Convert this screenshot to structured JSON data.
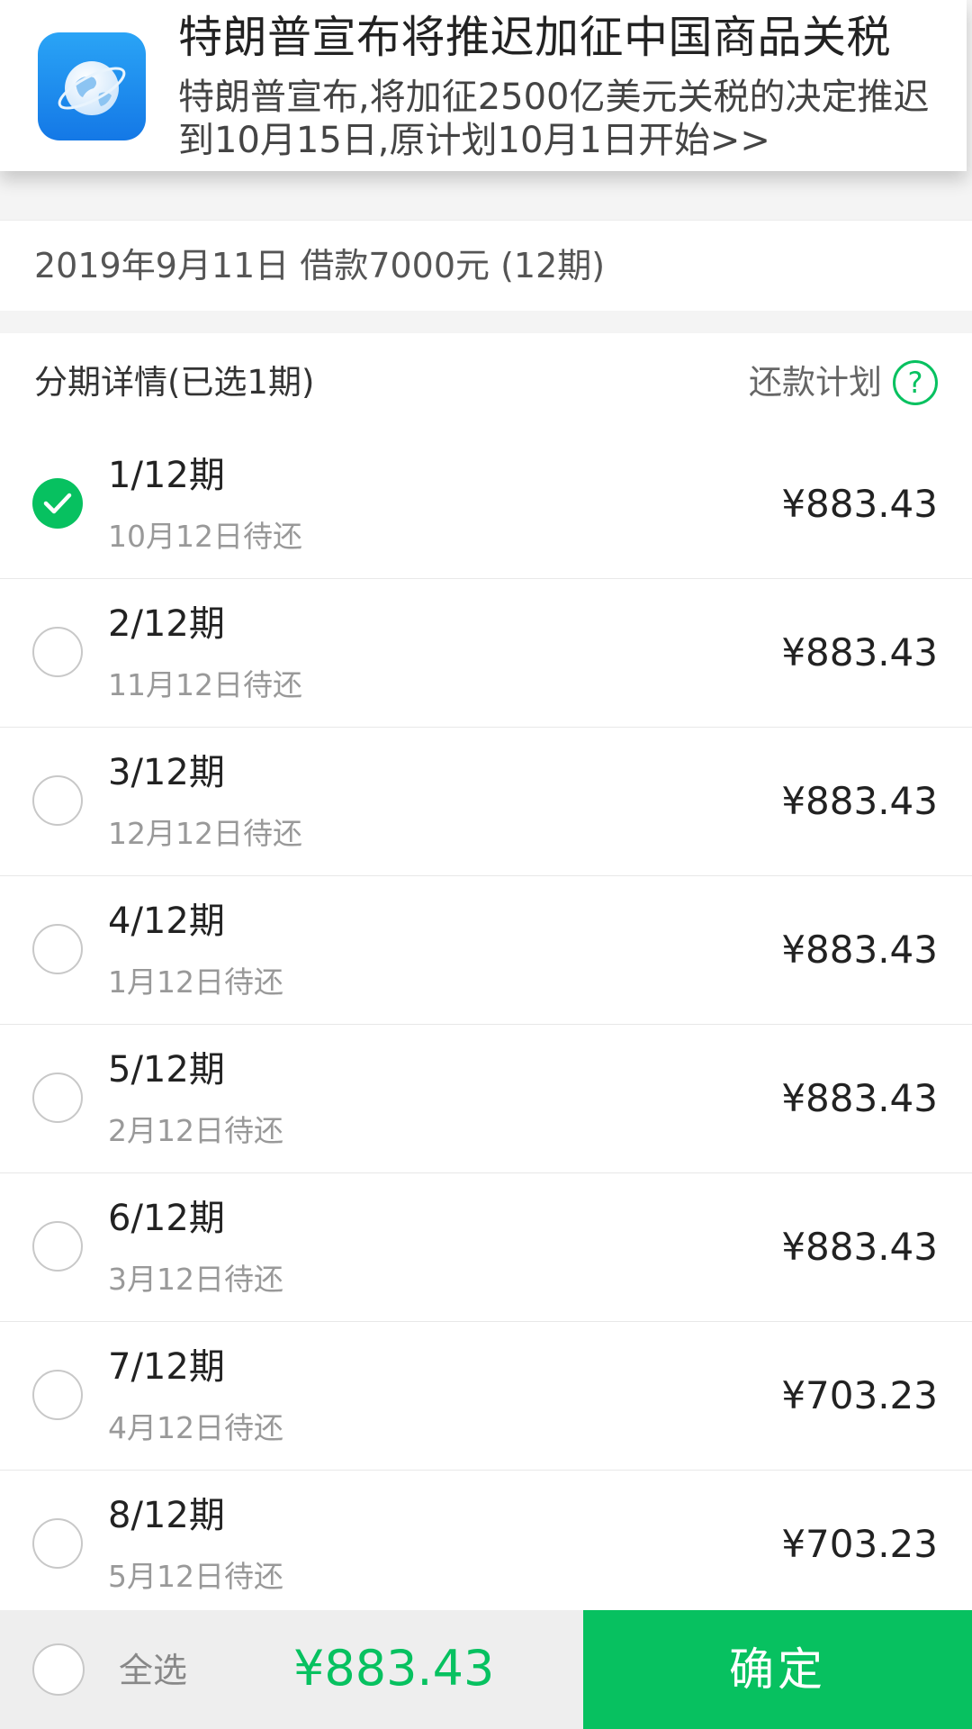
{
  "notification": {
    "app_icon": "browser-globe-icon",
    "title": "特朗普宣布将推迟加征中国商品关税",
    "body": "特朗普宣布,将加征2500亿美元关税的决定推迟到10月15日,原计划10月1日开始>>"
  },
  "loan": {
    "summary": "2019年9月11日 借款7000元 (12期)"
  },
  "section": {
    "title": "分期详情(已选1期)",
    "plan_link": "还款计划",
    "help_icon_glyph": "?"
  },
  "installments": [
    {
      "period": "1/12期",
      "due": "10月12日待还",
      "amount": "¥883.43",
      "checked": true
    },
    {
      "period": "2/12期",
      "due": "11月12日待还",
      "amount": "¥883.43",
      "checked": false
    },
    {
      "period": "3/12期",
      "due": "12月12日待还",
      "amount": "¥883.43",
      "checked": false
    },
    {
      "period": "4/12期",
      "due": "1月12日待还",
      "amount": "¥883.43",
      "checked": false
    },
    {
      "period": "5/12期",
      "due": "2月12日待还",
      "amount": "¥883.43",
      "checked": false
    },
    {
      "period": "6/12期",
      "due": "3月12日待还",
      "amount": "¥883.43",
      "checked": false
    },
    {
      "period": "7/12期",
      "due": "4月12日待还",
      "amount": "¥703.23",
      "checked": false
    },
    {
      "period": "8/12期",
      "due": "5月12日待还",
      "amount": "¥703.23",
      "checked": false
    }
  ],
  "bottom": {
    "select_all_label": "全选",
    "total": "¥883.43",
    "confirm_label": "确定"
  },
  "colors": {
    "accent": "#07c160",
    "background": "#f4f4f4"
  }
}
